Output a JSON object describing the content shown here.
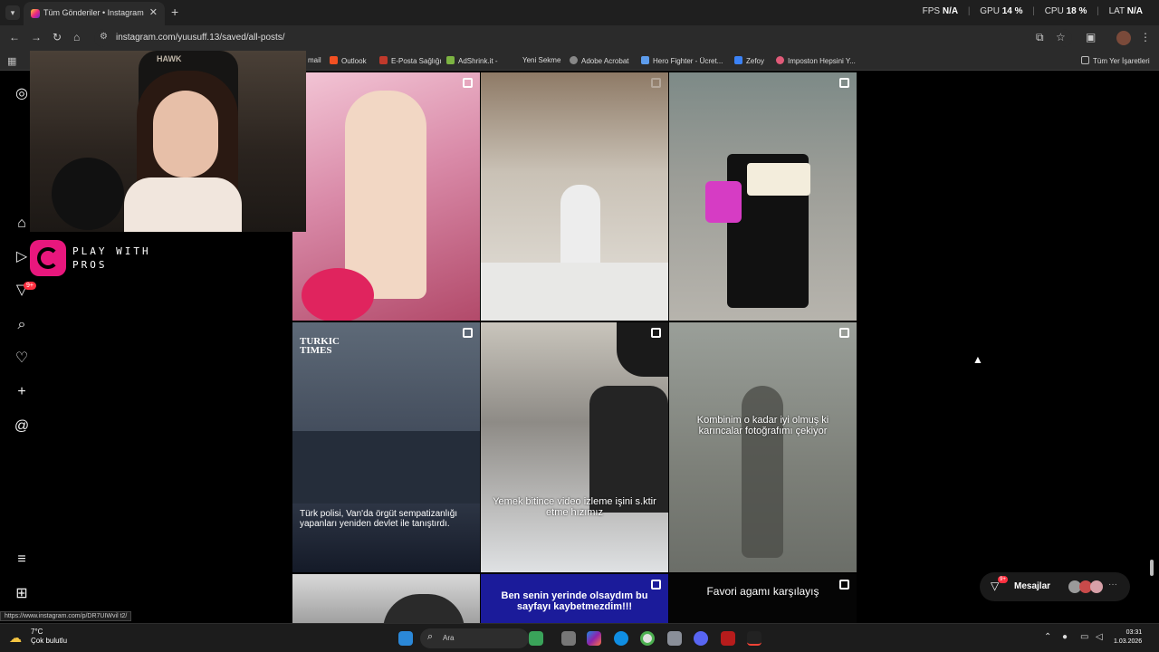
{
  "browser": {
    "tab_title": "Tüm Gönderiler • Instagram",
    "tab_close": "✕",
    "new_tab": "+",
    "url": "instagram.com/yuusuff.13/saved/all-posts/",
    "stats": {
      "fps_label": "FPS",
      "fps_value": "N/A",
      "gpu_label": "GPU",
      "gpu_value": "14 %",
      "cpu_label": "CPU",
      "cpu_value": "18 %",
      "lat_label": "LAT",
      "lat_value": "N/A"
    },
    "bookmarks": [
      {
        "label": "mail",
        "color": "#d44638"
      },
      {
        "label": "Outlook",
        "color": "#f25022"
      },
      {
        "label": "E-Posta Sağlığı",
        "color": "#c0392b"
      },
      {
        "label": "AdShrink.it -",
        "color": "#7cb342"
      },
      {
        "label": "Yeni Sekme",
        "color": "#555555"
      },
      {
        "label": "Adobe Acrobat",
        "color": "#888888"
      },
      {
        "label": "Hero Fighter - Ücret...",
        "color": "#5d9cec"
      },
      {
        "label": "Zefoy",
        "color": "#3b82f6"
      },
      {
        "label": "Imposton Hepsini Y...",
        "color": "#e05a78"
      }
    ],
    "all_bookmarks": "Tüm Yer İşaretleri",
    "status_url": "https://www.instagram.com/p/DR7UIWvil t2/"
  },
  "overlay": {
    "chair_text": "HAWK",
    "brand_line1": "PLAY WITH",
    "brand_line2": "PROS"
  },
  "nav": {
    "badge": "9+"
  },
  "posts": {
    "c4_header": "TURKIC\nTIMES",
    "c4_caption": "Türk polisi, Van'da örgüt sempatizanlığı yapanları yeniden devlet ile tanıştırdı.",
    "c5_caption": "Yemek bitince video izleme işini s.ktir etme hızımız",
    "c6_caption": "Kombinim o kadar iyi olmuş ki karıncalar fotoğrafımı çekiyor",
    "c8_caption": "Ben senin yerinde olsaydım bu sayfayı kaybetmezdim!!!",
    "c9_caption": "Favori agamı karşılayış"
  },
  "messages": {
    "label": "Mesajlar",
    "badge": "9+"
  },
  "taskbar": {
    "temp": "7°C",
    "weather": "Çok bulutlu",
    "search": "Ara",
    "time": "03:31",
    "date": "1.03.2026"
  }
}
